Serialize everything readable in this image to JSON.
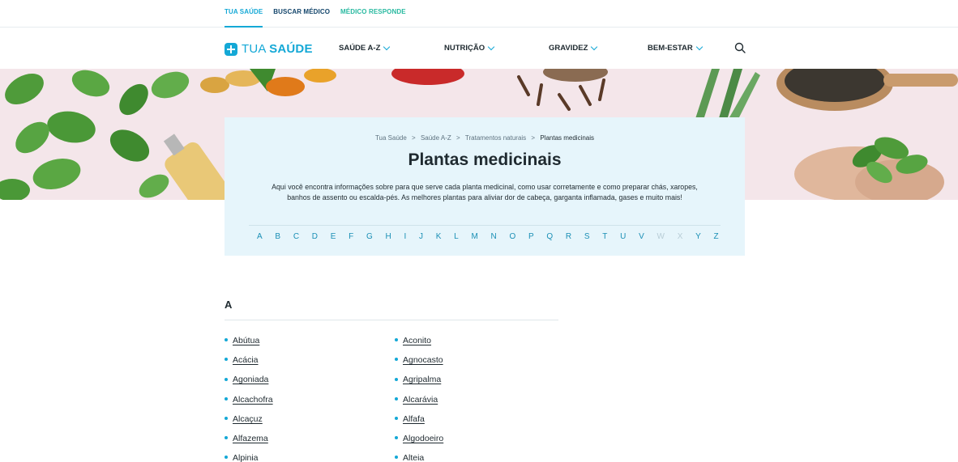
{
  "topbar": {
    "links": [
      "TUA SAÚDE",
      "BUSCAR MÉDICO",
      "MÉDICO RESPONDE"
    ]
  },
  "header": {
    "logo_prefix": "TUA ",
    "logo_bold": "SAÚDE",
    "nav": [
      "SAÚDE A-Z",
      "NUTRIÇÃO",
      "GRAVIDEZ",
      "BEM-ESTAR"
    ],
    "search_icon": "search-icon"
  },
  "breadcrumb": {
    "items": [
      "Tua Saúde",
      "Saúde A-Z",
      "Tratamentos naturais",
      "Plantas medicinais"
    ],
    "separator": ">"
  },
  "page": {
    "title": "Plantas medicinais",
    "description": "Aqui você encontra informações sobre para que serve cada planta medicinal, como usar corretamente e como preparar chás, xaropes, banhos de assento ou escalda-pés. As melhores plantas para aliviar dor de cabeça, garganta inflamada, gases e muito mais!"
  },
  "alphabet": {
    "letters": [
      "A",
      "B",
      "C",
      "D",
      "E",
      "F",
      "G",
      "H",
      "I",
      "J",
      "K",
      "L",
      "M",
      "N",
      "O",
      "P",
      "Q",
      "R",
      "S",
      "T",
      "U",
      "V",
      "W",
      "X",
      "Y",
      "Z"
    ],
    "disabled": [
      "W",
      "X"
    ]
  },
  "section": {
    "letter": "A",
    "left": [
      "Abútua",
      "Acácia",
      "Agoniada",
      "Alcachofra",
      "Alcaçuz",
      "Alfazema",
      "Alpinia"
    ],
    "right": [
      "Aconito",
      "Agnocasto",
      "Agripalma",
      "Alcarávia",
      "Alfafa",
      "Algodoeiro",
      "Alteia"
    ]
  },
  "colors": {
    "accent": "#14a8d6",
    "dark_blue": "#13456b",
    "teal": "#28b9a0",
    "card_bg": "#e6f5fb",
    "hero_bg": "#f4e6ea"
  }
}
